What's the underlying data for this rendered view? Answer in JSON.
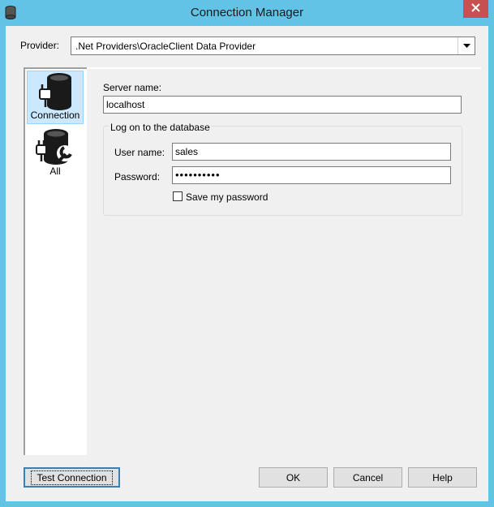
{
  "window": {
    "title": "Connection Manager"
  },
  "provider": {
    "label": "Provider:",
    "value": ".Net Providers\\OracleClient Data Provider"
  },
  "nav": {
    "items": [
      {
        "label": "Connection",
        "selected": true,
        "icon": "database-plug-icon"
      },
      {
        "label": "All",
        "selected": false,
        "icon": "database-wrench-icon"
      }
    ]
  },
  "form": {
    "server_name_label": "Server name:",
    "server_name_value": "localhost",
    "logon_group_title": "Log on to the database",
    "user_name_label": "User name:",
    "user_name_value": "sales",
    "password_label": "Password:",
    "password_value": "••••••••••",
    "save_password_label": "Save my password",
    "save_password_checked": false
  },
  "buttons": {
    "test_connection": "Test Connection",
    "ok": "OK",
    "cancel": "Cancel",
    "help": "Help"
  },
  "colors": {
    "title_bar": "#62c3e6",
    "close_button": "#c75050",
    "selection": "#cce8ff"
  }
}
